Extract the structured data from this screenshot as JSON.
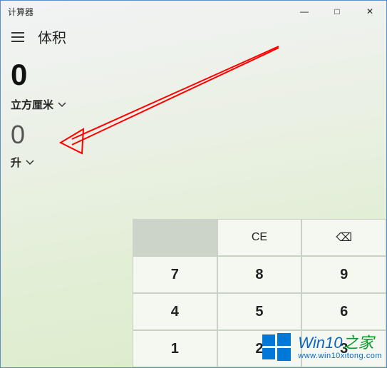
{
  "titlebar": {
    "title": "计算器"
  },
  "window_controls": {
    "minimize": "—",
    "maximize": "□",
    "close": "✕"
  },
  "header": {
    "hamburger_icon": "menu-icon",
    "mode": "体积"
  },
  "converter": {
    "input_value": "0",
    "input_unit": "立方厘米",
    "output_value": "0",
    "output_unit": "升"
  },
  "keypad": {
    "ce": "CE",
    "backspace": "⌫",
    "keys": [
      "7",
      "8",
      "9",
      "4",
      "5",
      "6",
      "1",
      "2",
      "3"
    ]
  },
  "watermark": {
    "title_main": "Win10",
    "title_suffix": "之家",
    "url": "www.win10xitong.com"
  },
  "colors": {
    "accent": "#5a8fc7",
    "arrow": "#ff0000"
  }
}
